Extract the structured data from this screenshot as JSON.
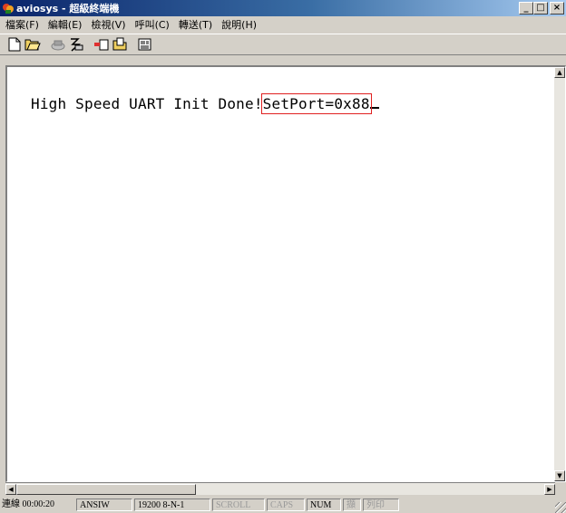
{
  "window": {
    "title": "aviosys - 超級終端機",
    "controls": {
      "minimize": "_",
      "maximize": "□",
      "close": "×"
    }
  },
  "menu": {
    "items": [
      {
        "label": "檔案(F)"
      },
      {
        "label": "編輯(E)"
      },
      {
        "label": "檢視(V)"
      },
      {
        "label": "呼叫(C)"
      },
      {
        "label": "轉送(T)"
      },
      {
        "label": "說明(H)"
      }
    ]
  },
  "toolbar": {
    "buttons": [
      "new-icon",
      "open-icon",
      "connect-icon",
      "disconnect-icon",
      "send-icon",
      "receive-icon",
      "properties-icon"
    ]
  },
  "terminal": {
    "text_before": "High Speed UART Init Done!",
    "highlighted_text": "SetPort=0x88",
    "highlight_color": "#e02020"
  },
  "statusbar": {
    "connection": "連線 00:00:20",
    "emulation": "ANSIW",
    "port_settings": "19200 8-N-1",
    "scroll": "SCROLL",
    "caps": "CAPS",
    "num": "NUM",
    "capture": "擷",
    "print": "列印"
  }
}
